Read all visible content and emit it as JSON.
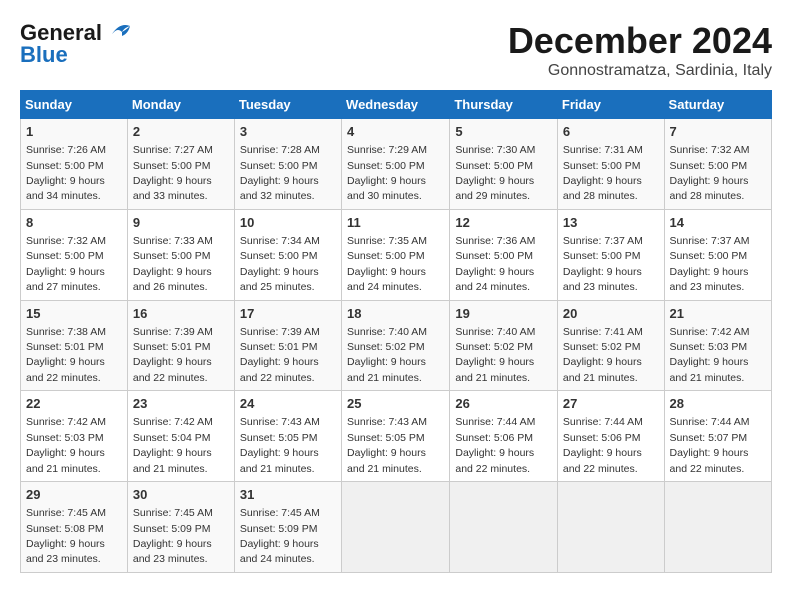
{
  "logo": {
    "line1": "General",
    "line2": "Blue"
  },
  "title": "December 2024",
  "location": "Gonnostramatza, Sardinia, Italy",
  "headers": [
    "Sunday",
    "Monday",
    "Tuesday",
    "Wednesday",
    "Thursday",
    "Friday",
    "Saturday"
  ],
  "weeks": [
    [
      {
        "day": "1",
        "detail": "Sunrise: 7:26 AM\nSunset: 5:00 PM\nDaylight: 9 hours\nand 34 minutes."
      },
      {
        "day": "2",
        "detail": "Sunrise: 7:27 AM\nSunset: 5:00 PM\nDaylight: 9 hours\nand 33 minutes."
      },
      {
        "day": "3",
        "detail": "Sunrise: 7:28 AM\nSunset: 5:00 PM\nDaylight: 9 hours\nand 32 minutes."
      },
      {
        "day": "4",
        "detail": "Sunrise: 7:29 AM\nSunset: 5:00 PM\nDaylight: 9 hours\nand 30 minutes."
      },
      {
        "day": "5",
        "detail": "Sunrise: 7:30 AM\nSunset: 5:00 PM\nDaylight: 9 hours\nand 29 minutes."
      },
      {
        "day": "6",
        "detail": "Sunrise: 7:31 AM\nSunset: 5:00 PM\nDaylight: 9 hours\nand 28 minutes."
      },
      {
        "day": "7",
        "detail": "Sunrise: 7:32 AM\nSunset: 5:00 PM\nDaylight: 9 hours\nand 28 minutes."
      }
    ],
    [
      {
        "day": "8",
        "detail": "Sunrise: 7:32 AM\nSunset: 5:00 PM\nDaylight: 9 hours\nand 27 minutes."
      },
      {
        "day": "9",
        "detail": "Sunrise: 7:33 AM\nSunset: 5:00 PM\nDaylight: 9 hours\nand 26 minutes."
      },
      {
        "day": "10",
        "detail": "Sunrise: 7:34 AM\nSunset: 5:00 PM\nDaylight: 9 hours\nand 25 minutes."
      },
      {
        "day": "11",
        "detail": "Sunrise: 7:35 AM\nSunset: 5:00 PM\nDaylight: 9 hours\nand 24 minutes."
      },
      {
        "day": "12",
        "detail": "Sunrise: 7:36 AM\nSunset: 5:00 PM\nDaylight: 9 hours\nand 24 minutes."
      },
      {
        "day": "13",
        "detail": "Sunrise: 7:37 AM\nSunset: 5:00 PM\nDaylight: 9 hours\nand 23 minutes."
      },
      {
        "day": "14",
        "detail": "Sunrise: 7:37 AM\nSunset: 5:00 PM\nDaylight: 9 hours\nand 23 minutes."
      }
    ],
    [
      {
        "day": "15",
        "detail": "Sunrise: 7:38 AM\nSunset: 5:01 PM\nDaylight: 9 hours\nand 22 minutes."
      },
      {
        "day": "16",
        "detail": "Sunrise: 7:39 AM\nSunset: 5:01 PM\nDaylight: 9 hours\nand 22 minutes."
      },
      {
        "day": "17",
        "detail": "Sunrise: 7:39 AM\nSunset: 5:01 PM\nDaylight: 9 hours\nand 22 minutes."
      },
      {
        "day": "18",
        "detail": "Sunrise: 7:40 AM\nSunset: 5:02 PM\nDaylight: 9 hours\nand 21 minutes."
      },
      {
        "day": "19",
        "detail": "Sunrise: 7:40 AM\nSunset: 5:02 PM\nDaylight: 9 hours\nand 21 minutes."
      },
      {
        "day": "20",
        "detail": "Sunrise: 7:41 AM\nSunset: 5:02 PM\nDaylight: 9 hours\nand 21 minutes."
      },
      {
        "day": "21",
        "detail": "Sunrise: 7:42 AM\nSunset: 5:03 PM\nDaylight: 9 hours\nand 21 minutes."
      }
    ],
    [
      {
        "day": "22",
        "detail": "Sunrise: 7:42 AM\nSunset: 5:03 PM\nDaylight: 9 hours\nand 21 minutes."
      },
      {
        "day": "23",
        "detail": "Sunrise: 7:42 AM\nSunset: 5:04 PM\nDaylight: 9 hours\nand 21 minutes."
      },
      {
        "day": "24",
        "detail": "Sunrise: 7:43 AM\nSunset: 5:05 PM\nDaylight: 9 hours\nand 21 minutes."
      },
      {
        "day": "25",
        "detail": "Sunrise: 7:43 AM\nSunset: 5:05 PM\nDaylight: 9 hours\nand 21 minutes."
      },
      {
        "day": "26",
        "detail": "Sunrise: 7:44 AM\nSunset: 5:06 PM\nDaylight: 9 hours\nand 22 minutes."
      },
      {
        "day": "27",
        "detail": "Sunrise: 7:44 AM\nSunset: 5:06 PM\nDaylight: 9 hours\nand 22 minutes."
      },
      {
        "day": "28",
        "detail": "Sunrise: 7:44 AM\nSunset: 5:07 PM\nDaylight: 9 hours\nand 22 minutes."
      }
    ],
    [
      {
        "day": "29",
        "detail": "Sunrise: 7:45 AM\nSunset: 5:08 PM\nDaylight: 9 hours\nand 23 minutes."
      },
      {
        "day": "30",
        "detail": "Sunrise: 7:45 AM\nSunset: 5:09 PM\nDaylight: 9 hours\nand 23 minutes."
      },
      {
        "day": "31",
        "detail": "Sunrise: 7:45 AM\nSunset: 5:09 PM\nDaylight: 9 hours\nand 24 minutes."
      },
      {
        "day": "",
        "detail": ""
      },
      {
        "day": "",
        "detail": ""
      },
      {
        "day": "",
        "detail": ""
      },
      {
        "day": "",
        "detail": ""
      }
    ]
  ]
}
